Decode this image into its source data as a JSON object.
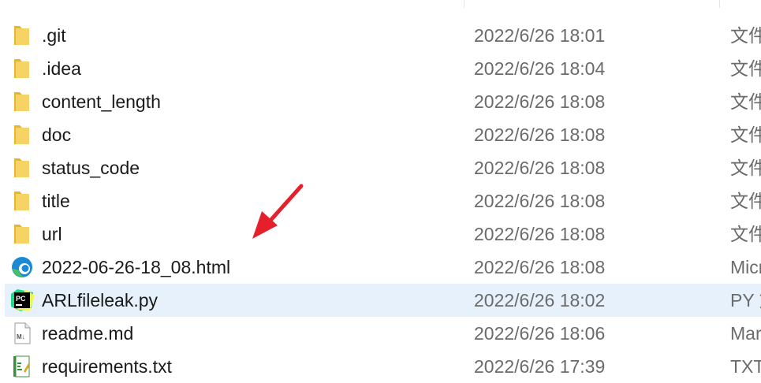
{
  "file_list": {
    "rows": [
      {
        "name": ".git",
        "date": "2022/6/26 18:01",
        "type": "文件夹",
        "icon": "folder-icon"
      },
      {
        "name": ".idea",
        "date": "2022/6/26 18:04",
        "type": "文件夹",
        "icon": "folder-icon"
      },
      {
        "name": "content_length",
        "date": "2022/6/26 18:08",
        "type": "文件夹",
        "icon": "folder-icon"
      },
      {
        "name": "doc",
        "date": "2022/6/26 18:08",
        "type": "文件夹",
        "icon": "folder-icon"
      },
      {
        "name": "status_code",
        "date": "2022/6/26 18:08",
        "type": "文件夹",
        "icon": "folder-icon"
      },
      {
        "name": "title",
        "date": "2022/6/26 18:08",
        "type": "文件夹",
        "icon": "folder-icon"
      },
      {
        "name": "url",
        "date": "2022/6/26 18:08",
        "type": "文件夹",
        "icon": "folder-icon"
      },
      {
        "name": "2022-06-26-18_08.html",
        "date": "2022/6/26 18:08",
        "type": "Microsoft Edge HTML Document",
        "icon": "edge-icon"
      },
      {
        "name": "ARLfileleak.py",
        "date": "2022/6/26 18:02",
        "type": "PY 文件",
        "icon": "pycharm-icon",
        "selected": true
      },
      {
        "name": "readme.md",
        "date": "2022/6/26 18:06",
        "type": "Markdown",
        "icon": "markdown-file-icon"
      },
      {
        "name": "requirements.txt",
        "date": "2022/6/26 17:39",
        "type": "TXT 文件",
        "icon": "text-file-icon"
      }
    ]
  },
  "annotation": {
    "icon": "red-arrow-icon",
    "color": "#e5202a"
  },
  "colors": {
    "folder": "#f4c542",
    "selection": "#e6f1fb",
    "secondary_text": "#6b6b6b"
  }
}
